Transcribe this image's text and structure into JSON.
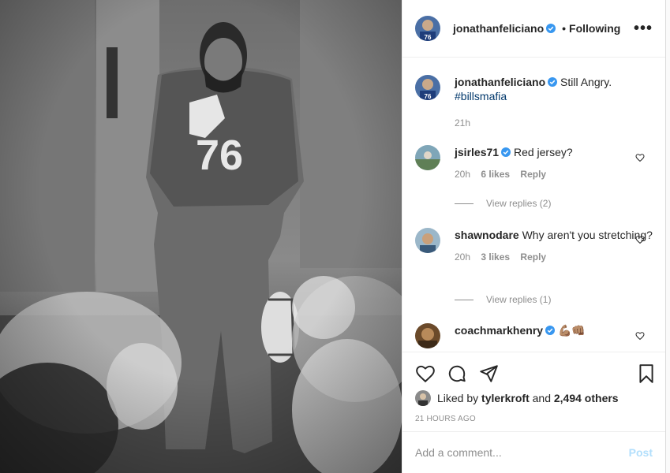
{
  "post": {
    "image_alt": "Black and white photo of player wearing jersey number 76",
    "jersey_number": "76",
    "author": "jonathanfeliciano",
    "follow_status": "Following",
    "separator": "•",
    "more_icon": "more-horizontal-icon"
  },
  "caption": {
    "username": "jonathanfeliciano",
    "text": "Still Angry.",
    "hashtag": "#billsmafia",
    "time": "21h"
  },
  "comments": [
    {
      "username": "jsirles71",
      "text": "Red jersey?",
      "time": "20h",
      "likes": "6 likes",
      "reply": "Reply",
      "view_replies": "View replies (2)"
    },
    {
      "username": "shawnodare",
      "text": "Why aren't you stretching?",
      "time": "20h",
      "likes": "3 likes",
      "reply": "Reply",
      "view_replies": "View replies (1)"
    },
    {
      "username": "coachmarkhenry",
      "text": "💪🏽👊🏽"
    }
  ],
  "likes": {
    "prefix": "Liked by",
    "user": "tylerkroft",
    "middle": "and",
    "count": "2,494 others"
  },
  "timestamp": "21 HOURS AGO",
  "add_comment": {
    "placeholder": "Add a comment...",
    "post_label": "Post"
  },
  "colors": {
    "verified": "#3897f0",
    "link": "#00376b",
    "muted": "#8e8e8e",
    "post_disabled": "#b2dffc"
  }
}
